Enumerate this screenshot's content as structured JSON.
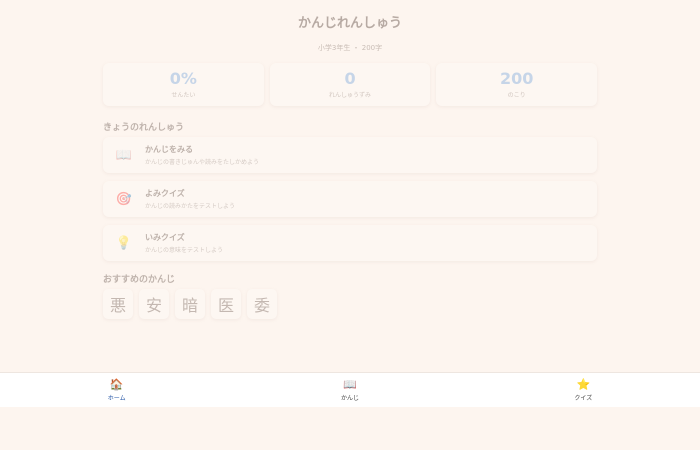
{
  "header": {
    "title": "かんじれんしゅう",
    "subtitle": "小学3年生 ・ 200字"
  },
  "stats": [
    {
      "value": "0%",
      "label": "せんたい"
    },
    {
      "value": "0",
      "label": "れんしゅうずみ"
    },
    {
      "value": "200",
      "label": "のこり"
    }
  ],
  "sections": {
    "practice_title": "きょうのれんしゅう",
    "recommended_title": "おすすめのかんじ"
  },
  "menu": [
    {
      "icon": "book-icon",
      "glyph": "📖",
      "title": "かんじをみる",
      "desc": "かんじの書きじゅんや読みをたしかめよう"
    },
    {
      "icon": "target-icon",
      "glyph": "🎯",
      "title": "よみクイズ",
      "desc": "かんじの読みかたをテストしよう"
    },
    {
      "icon": "lightbulb-icon",
      "glyph": "💡",
      "title": "いみクイズ",
      "desc": "かんじの意味をテストしよう"
    }
  ],
  "recommended_kanji": [
    "悪",
    "安",
    "暗",
    "医",
    "委"
  ],
  "nav": [
    {
      "icon": "house-icon",
      "glyph": "🏠",
      "label": "ホーム",
      "active": true
    },
    {
      "icon": "book-icon",
      "glyph": "📖",
      "label": "かんじ",
      "active": false
    },
    {
      "icon": "star-icon",
      "glyph": "⭐",
      "label": "クイズ",
      "active": false
    }
  ],
  "colors": {
    "background": "#fdf5ef",
    "accent": "#c6d5e8",
    "nav_active": "#2a5aa8"
  }
}
